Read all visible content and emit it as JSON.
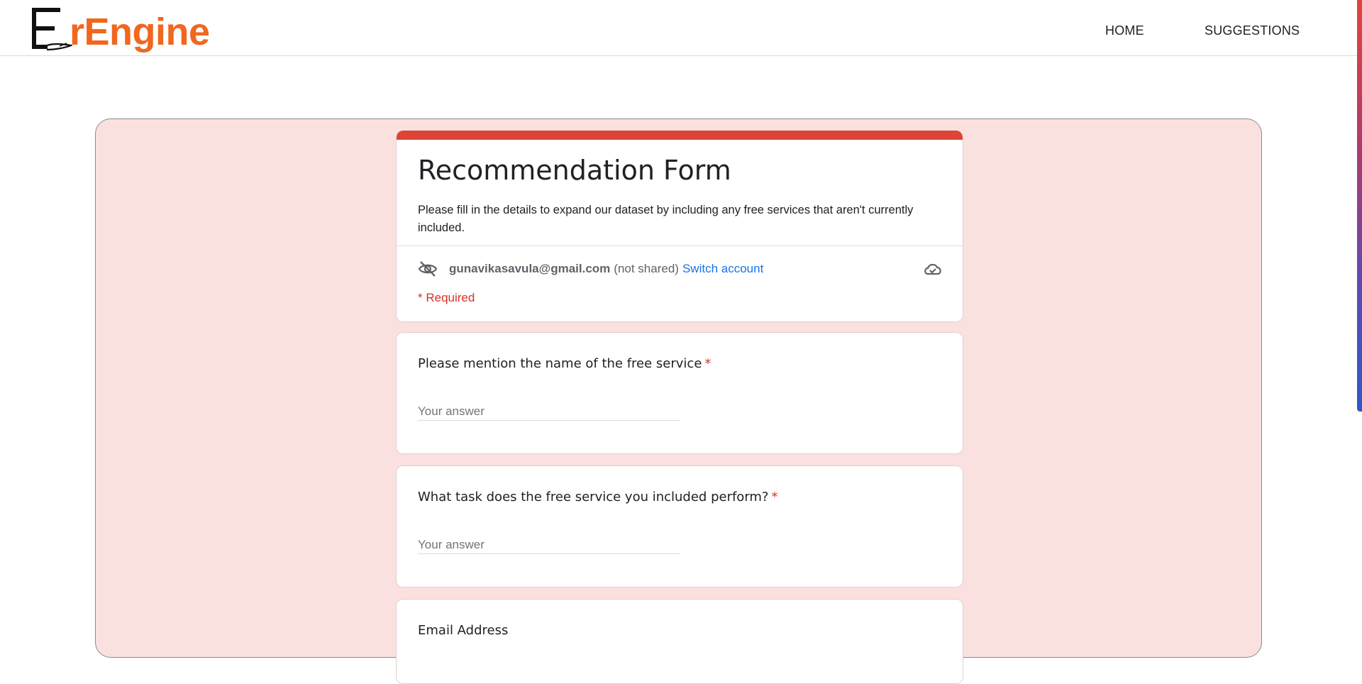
{
  "header": {
    "logo_text": "rEngine",
    "nav": [
      {
        "label": "HOME"
      },
      {
        "label": "SUGGESTIONS"
      }
    ]
  },
  "form": {
    "title": "Recommendation Form",
    "description": "Please fill in the details to expand our dataset by including any free services that aren't currently included.",
    "account": {
      "email": "gunavikasavula@gmail.com",
      "not_shared": "(not shared)",
      "switch_label": "Switch account"
    },
    "required_note": "* Required",
    "questions": [
      {
        "label": "Please mention the name of the free service",
        "required_mark": "*",
        "placeholder": "Your answer",
        "value": ""
      },
      {
        "label": "What task does the free service you included perform?",
        "required_mark": "*",
        "placeholder": "Your answer",
        "value": ""
      },
      {
        "label": "Email Address"
      }
    ]
  },
  "colors": {
    "brand_orange": "#f2661e",
    "form_accent": "#db4437",
    "frame_background": "#fae1e0",
    "link_blue": "#1a73e8",
    "required_red": "#d93025"
  },
  "icons": [
    "logo-e-icon",
    "eye-off-icon",
    "cloud-check-icon"
  ]
}
